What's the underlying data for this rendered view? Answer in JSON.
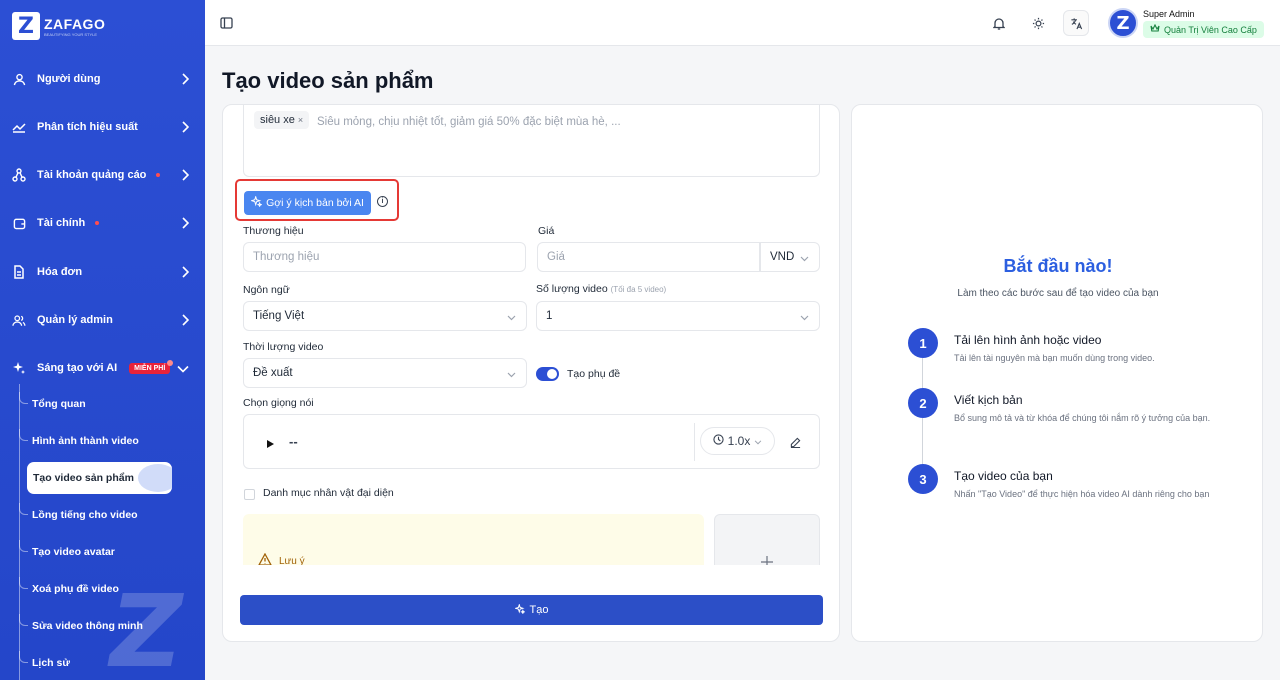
{
  "brand": {
    "name": "ZAFAGO",
    "tagline": "BEAUTIFYING YOUR STYLE"
  },
  "sidebar": {
    "items": [
      {
        "label": "Người dùng"
      },
      {
        "label": "Phân tích hiệu suất"
      },
      {
        "label": "Tài khoản quảng cáo"
      },
      {
        "label": "Tài chính"
      },
      {
        "label": "Hóa đơn"
      },
      {
        "label": "Quản lý admin"
      },
      {
        "label": "Sáng tạo với AI",
        "badge": "MIỄN PHÍ"
      }
    ],
    "subitems": [
      {
        "label": "Tổng quan"
      },
      {
        "label": "Hình ảnh thành video"
      },
      {
        "label": "Tạo video sản phẩm",
        "active": true
      },
      {
        "label": "Lồng tiếng cho video"
      },
      {
        "label": "Tạo video avatar"
      },
      {
        "label": "Xoá phụ đề video"
      },
      {
        "label": "Sửa video thông minh"
      },
      {
        "label": "Lịch sử"
      }
    ]
  },
  "topbar": {
    "user_name": "Super Admin",
    "user_role": "Quản Trị Viên Cao Cấp",
    "avatar_letter": "Z"
  },
  "page": {
    "title": "Tạo video sản phẩm"
  },
  "form": {
    "keyword_tag": "siêu xe",
    "keyword_placeholder": "Siêu mỏng, chịu nhiệt tốt, giảm giá 50% đặc biệt mùa hè, ...",
    "ai_button": "Gợi ý kịch bản bởi AI",
    "brand_label": "Thương hiệu",
    "brand_placeholder": "Thương hiệu",
    "price_label": "Giá",
    "price_placeholder": "Giá",
    "currency": "VND",
    "language_label": "Ngôn ngữ",
    "language_value": "Tiếng Việt",
    "video_count_label": "Số lượng video",
    "video_count_hint": "(Tối đa 5 video)",
    "video_count_value": "1",
    "duration_label": "Thời lượng video",
    "duration_value": "Đề xuất",
    "subtitle_toggle_label": "Tạo phụ đề",
    "subtitle_toggle_on": true,
    "voice_label": "Chọn giọng nói",
    "voice_value": "--",
    "speed_value": "1.0x",
    "character_checkbox_label": "Danh mục nhân vật đại diện",
    "note_label": "Lưu ý",
    "create_button": "Tạo"
  },
  "guide": {
    "title": "Bắt đầu nào!",
    "subtitle": "Làm theo các bước sau để tạo video của bạn",
    "steps": [
      {
        "num": "1",
        "title": "Tải lên hình ảnh hoặc video",
        "desc": "Tải lên tài nguyên mà bạn muốn dùng trong video."
      },
      {
        "num": "2",
        "title": "Viết kịch bản",
        "desc": "Bổ sung mô tả và từ khóa để chúng tôi nắm rõ ý tưởng của bạn."
      },
      {
        "num": "3",
        "title": "Tạo video của bạn",
        "desc": "Nhấn \"Tạo Video\" để thực hiện hóa video AI dành riêng cho bạn"
      }
    ]
  },
  "colors": {
    "primary": "#2c4fd4",
    "accent_blue": "#4a86f0",
    "highlight_red": "#e53935",
    "badge_red": "#e8233a"
  }
}
